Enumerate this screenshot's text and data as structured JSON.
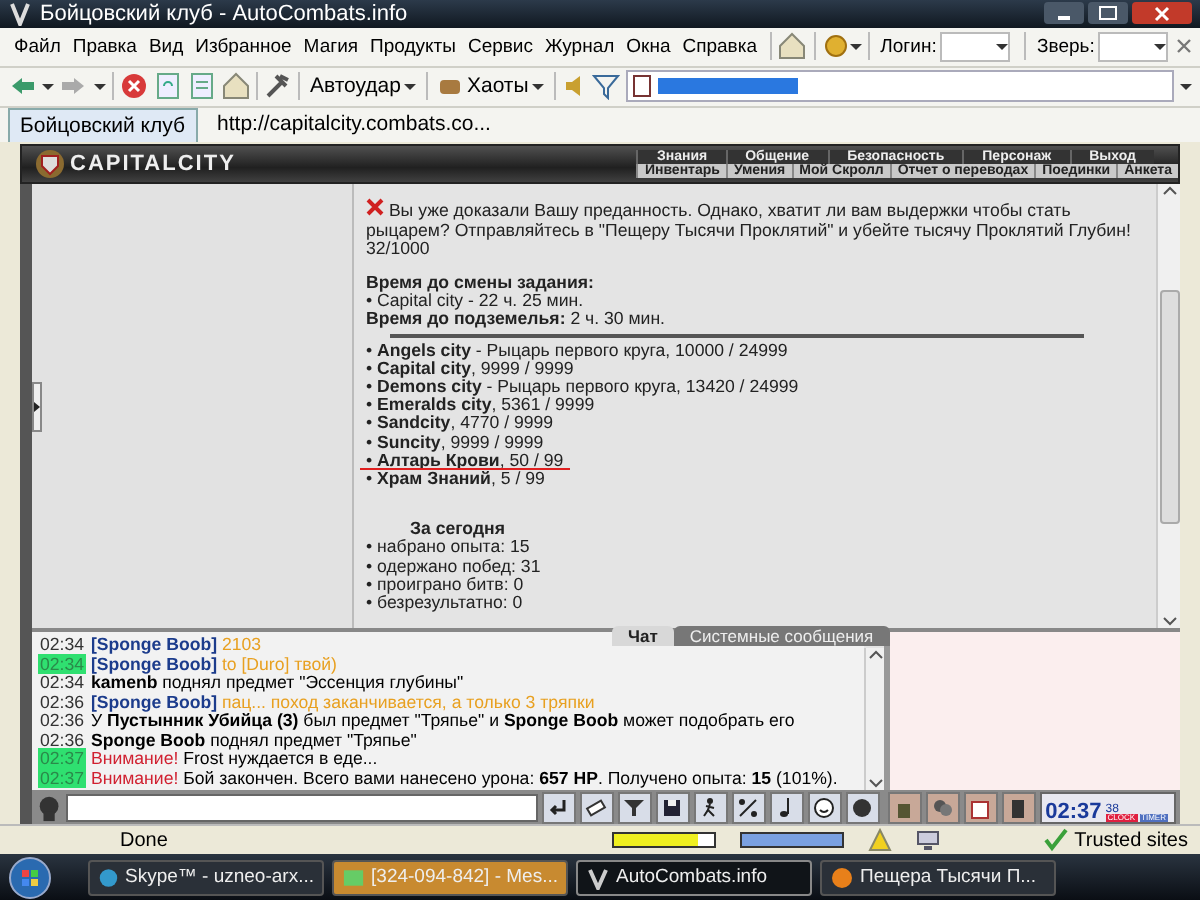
{
  "window": {
    "title": "Бойцовский клуб - AutoCombats.info"
  },
  "menu": [
    "Файл",
    "Правка",
    "Вид",
    "Избранное",
    "Магия",
    "Продукты",
    "Сервис",
    "Журнал",
    "Окна",
    "Справка"
  ],
  "login": {
    "label": "Логин:"
  },
  "pet": {
    "label": "Зверь:"
  },
  "toolbar": {
    "autohit": "Автоудар",
    "chaos": "Хаоты"
  },
  "tabs": [
    {
      "label": "Бойцовский клуб",
      "selected": true
    },
    {
      "label": "http://capitalcity.combats.co...",
      "selected": false
    }
  ],
  "game_nav": {
    "logo": "CAPITALCITY",
    "top": [
      "Знания",
      "Общение",
      "Безопасность",
      "Персонаж",
      "Выход"
    ],
    "sub": [
      "Инвентарь",
      "Умения",
      "Мой Скролл",
      "Отчет о переводах",
      "Поединки",
      "Анкета"
    ]
  },
  "quest": {
    "text": "Вы уже доказали Вашу преданность. Однако, хватит ли вам выдержки чтобы стать рыцарем? Отправляйтесь в \"Пещеру Тысячи Проклятий\" и убейте тысячу Проклятий Глубин!",
    "progress": "32/1000"
  },
  "timers": {
    "heading": "Время до смены задания:",
    "lines": [
      "• Capital city - 22 ч. 25 мин.",
      "**Время до подземелья:** 2 ч. 30 мин."
    ]
  },
  "cities": [
    {
      "text": "• **Angels city** - Рыцарь первого круга, 10000 / 24999",
      "marked": false
    },
    {
      "text": "• **Capital city**, 9999 / 9999",
      "marked": false
    },
    {
      "text": "• **Demons city** - Рыцарь первого круга, 13420 / 24999",
      "marked": false
    },
    {
      "text": "• **Emeralds city**, 5361 / 9999",
      "marked": false
    },
    {
      "text": "• **Sandcity**, 4770 / 9999",
      "marked": false
    },
    {
      "text": "• **Suncity**, 9999 / 9999",
      "marked": false
    },
    {
      "text": "• **Алтарь Крови**, 50 / 99",
      "marked": true
    },
    {
      "text": "• **Храм Знаний**, 5 / 99",
      "marked": false
    }
  ],
  "today": {
    "heading": "За сегодня",
    "stats": [
      "• набрано опыта: 15",
      "• одержано побед: 31",
      "• проиграно битв: 0",
      "• безрезультатно: 0"
    ]
  },
  "chat": {
    "tabs": [
      {
        "label": "Чат",
        "selected": true
      },
      {
        "label": "Системные сообщения",
        "selected": false
      }
    ],
    "messages": [
      {
        "time": "02:34",
        "highlighted": false,
        "parts": [
          {
            "kind": "nick",
            "text": "[Sponge Boob]"
          },
          {
            "kind": "private",
            "text": "2103"
          }
        ]
      },
      {
        "time": "02:34",
        "highlighted": true,
        "parts": [
          {
            "kind": "nick",
            "text": "[Sponge Boob]"
          },
          {
            "kind": "private",
            "text": "to [Duro] твой)"
          }
        ]
      },
      {
        "time": "02:34",
        "highlighted": false,
        "parts": [
          {
            "kind": "text",
            "text": "**kamenb** поднял предмет \"Эссенция глубины\""
          }
        ]
      },
      {
        "time": "02:36",
        "highlighted": false,
        "parts": [
          {
            "kind": "nick",
            "text": "[Sponge Boob]"
          },
          {
            "kind": "private",
            "text": "пац... поход заканчивается, а только 3 тряпки"
          }
        ]
      },
      {
        "time": "02:36",
        "highlighted": false,
        "parts": [
          {
            "kind": "text",
            "text": "У **Пустынник Убийца (3)** был предмет \"Тряпье\" и **Sponge Boob** может подобрать его"
          }
        ]
      },
      {
        "time": "02:36",
        "highlighted": false,
        "parts": [
          {
            "kind": "text",
            "text": "**Sponge Boob** поднял предмет \"Тряпье\""
          }
        ]
      },
      {
        "time": "02:37",
        "highlighted": true,
        "parts": [
          {
            "kind": "alert",
            "text": "Внимание!"
          },
          {
            "kind": "text",
            "text": "Frost нуждается в еде..."
          }
        ]
      },
      {
        "time": "02:37",
        "highlighted": true,
        "parts": [
          {
            "kind": "alert",
            "text": "Внимание!"
          },
          {
            "kind": "text",
            "text": "Бой закончен. Всего вами нанесено урона: **657 HP**. Получено опыта: **15** (101%)."
          }
        ]
      }
    ]
  },
  "clock": {
    "time": "02:37",
    "seconds": "38",
    "labels": [
      "CLOCK",
      "TIMER"
    ]
  },
  "status": {
    "text": "Done",
    "meters": [
      {
        "level": 0.83
      },
      {
        "level": 1
      }
    ],
    "zone": "Trusted sites"
  },
  "taskbar": [
    {
      "label": "Skype™ - uzneo-arx...",
      "selected": false,
      "attention": false
    },
    {
      "label": "[324-094-842] - Mes...",
      "selected": false,
      "attention": true
    },
    {
      "label": "AutoCombats.info",
      "selected": true,
      "attention": false
    },
    {
      "label": "Пещера Тысячи П...",
      "selected": false,
      "attention": false
    }
  ]
}
